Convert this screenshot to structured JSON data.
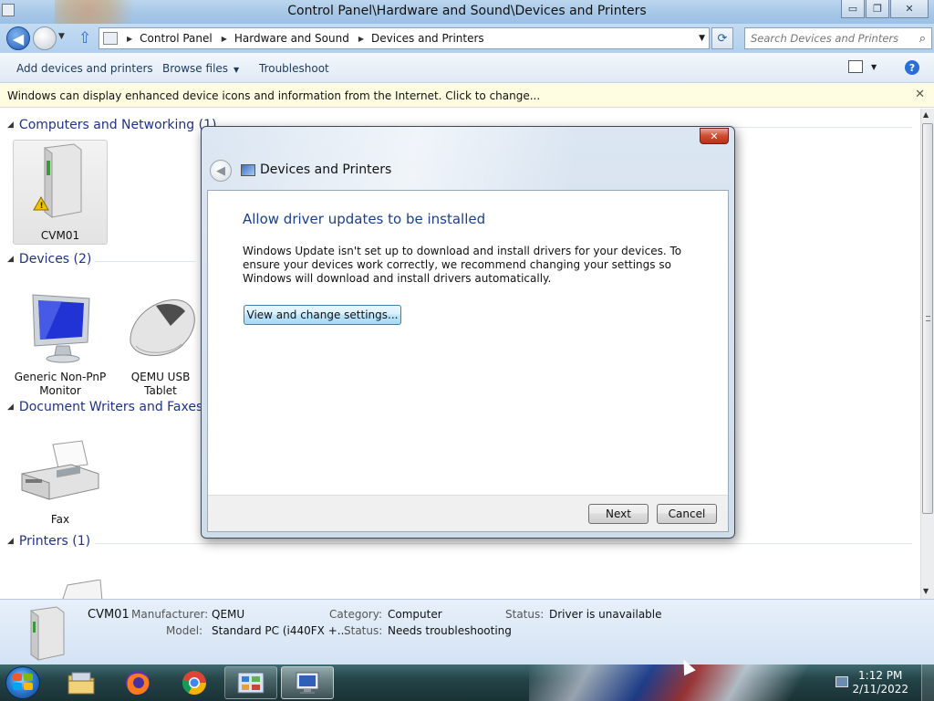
{
  "window": {
    "title": "Control Panel\\Hardware and Sound\\Devices and Printers",
    "controls": {
      "minimize": "▭",
      "maximize": "❐",
      "close": "✕"
    }
  },
  "address": {
    "crumbs": [
      "Control Panel",
      "Hardware and Sound",
      "Devices and Printers"
    ],
    "search_placeholder": "Search Devices and Printers"
  },
  "toolbar": {
    "add_devices": "Add devices and printers",
    "browse_files": "Browse files",
    "troubleshoot": "Troubleshoot",
    "help": "?"
  },
  "infobar": {
    "text": "Windows can display enhanced device icons and information from the Internet. Click to change...",
    "close": "✕"
  },
  "groups": {
    "computers": {
      "title": "Computers and Networking (1)",
      "items": [
        {
          "label": "CVM01"
        }
      ]
    },
    "devices": {
      "title": "Devices (2)",
      "items": [
        {
          "label": "Generic Non-PnP Monitor"
        },
        {
          "label": "QEMU USB Tablet"
        }
      ]
    },
    "document_writers": {
      "title": "Document Writers and Faxes (",
      "items": [
        {
          "label": "Fax"
        }
      ]
    },
    "printers": {
      "title": "Printers (1)"
    }
  },
  "details": {
    "name": "CVM01",
    "manufacturer_label": "Manufacturer:",
    "manufacturer_value": "QEMU",
    "model_label": "Model:",
    "model_value": "Standard PC (i440FX +...",
    "category_label": "Category:",
    "category_value": "Computer",
    "status_label": "Status:",
    "status_value_1": "Needs troubleshooting",
    "status_label_2": "Status:",
    "status_value_2": "Driver is unavailable"
  },
  "dialog": {
    "title": "Devices and Printers",
    "heading": "Allow driver updates to be installed",
    "body": "Windows Update isn't set up to download and install drivers for your devices. To ensure your devices work correctly, we recommend changing your settings so Windows will download and install drivers automatically.",
    "settings_button": "View and change settings...",
    "next_button": "Next",
    "cancel_button": "Cancel",
    "close": "✕"
  },
  "taskbar": {
    "time": "1:12 PM",
    "date": "2/11/2022",
    "apps": [
      "windows-explorer",
      "firefox",
      "chrome",
      "control-panel",
      "devices-and-printers"
    ]
  },
  "colors": {
    "group_header": "#1e3287",
    "dialog_heading": "#1b3f8f",
    "infobar_bg": "#fffde1"
  }
}
